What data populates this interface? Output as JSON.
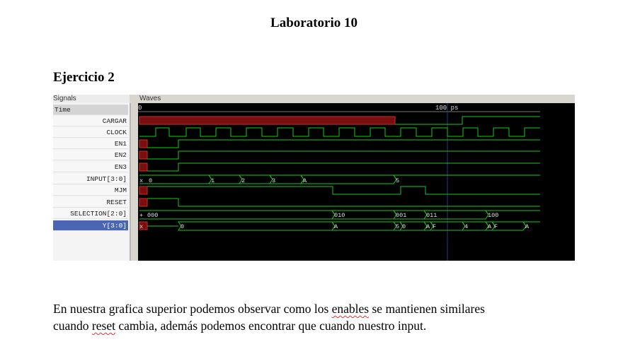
{
  "document": {
    "title": "Laboratorio 10",
    "heading": "Ejercicio 2",
    "paragraph_lines": [
      [
        "En nuestra grafica superior podemos observar como los ",
        "enables",
        " se mantienen similares"
      ],
      [
        "cuando ",
        "reset",
        " cambia, además podemos encontrar que cuando nuestro input."
      ]
    ]
  },
  "viewer": {
    "signals_label": "Signals",
    "waves_label": "Waves",
    "signals": [
      "Time",
      "CARGAR",
      "CLOCK",
      "EN1",
      "EN2",
      "EN3",
      "INPUT[3:0]",
      "MJM",
      "RESET",
      "SELECTION[2:0]",
      "Y[3:0]"
    ],
    "selected_signal": "Y[3:0]",
    "time_labels": {
      "start": "0",
      "marker": "100 ps"
    },
    "waves": {
      "INPUT": [
        "x",
        "0",
        "1",
        "2",
        "3",
        "A",
        "5"
      ],
      "SELECTION": [
        "+",
        "000",
        "010",
        "001",
        "011",
        "100"
      ],
      "Y": [
        "x",
        "0",
        "A",
        "5",
        "0",
        "A",
        "F",
        "4",
        "A",
        "F",
        "A"
      ]
    },
    "colors": {
      "wave": "#19c819",
      "undefined": "#8b1010",
      "background": "#000000",
      "selection": "#4a66b3"
    }
  }
}
